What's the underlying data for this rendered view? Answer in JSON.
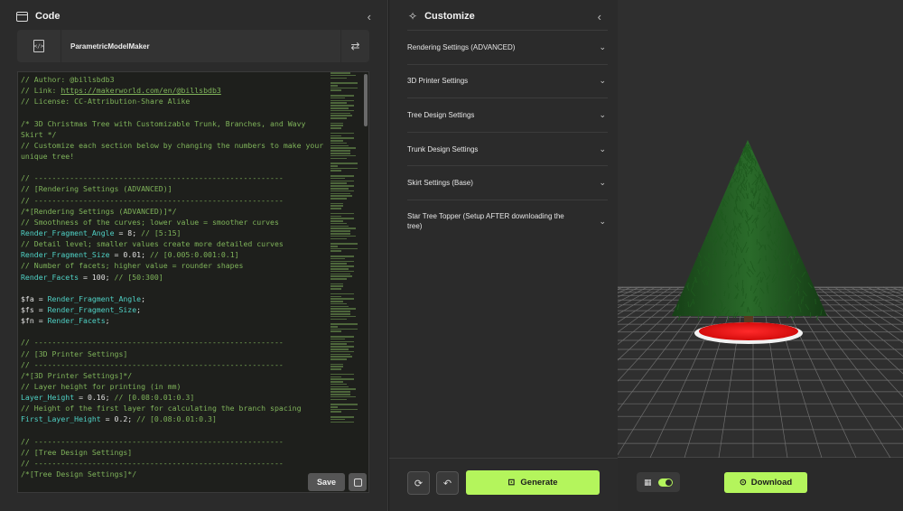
{
  "code_panel": {
    "title": "Code",
    "file_name": "ParametricModelMaker",
    "save_label": "Save",
    "lines": [
      [
        [
          "c-com",
          "// Author: @billsbdb3"
        ]
      ],
      [
        [
          "c-com",
          "// Link: "
        ],
        [
          "c-link",
          "https://makerworld.com/en/@billsbdb3"
        ]
      ],
      [
        [
          "c-com",
          "// License: CC-Attribution-Share Alike"
        ]
      ],
      [],
      [
        [
          "c-com",
          "/* 3D Christmas Tree with Customizable Trunk, Branches, and Wavy"
        ]
      ],
      [
        [
          "c-com",
          "Skirt */"
        ]
      ],
      [
        [
          "c-com",
          "// Customize each section below by changing the numbers to make your"
        ]
      ],
      [
        [
          "c-com",
          "unique tree!"
        ]
      ],
      [],
      [
        [
          "c-com",
          "// --------------------------------------------------------"
        ]
      ],
      [
        [
          "c-com",
          "// [Rendering Settings (ADVANCED)]"
        ]
      ],
      [
        [
          "c-com",
          "// --------------------------------------------------------"
        ]
      ],
      [
        [
          "c-com",
          "/*[Rendering Settings (ADVANCED)]*/"
        ]
      ],
      [
        [
          "c-com",
          "// Smoothness of the curves; lower value = smoother curves"
        ]
      ],
      [
        [
          "c-var",
          "Render_Fragment_Angle"
        ],
        [
          "c-txt",
          " = 8; "
        ],
        [
          "c-com",
          "// [5:15]"
        ]
      ],
      [
        [
          "c-com",
          "// Detail level; smaller values create more detailed curves"
        ]
      ],
      [
        [
          "c-var",
          "Render_Fragment_Size"
        ],
        [
          "c-txt",
          " = 0.01; "
        ],
        [
          "c-com",
          "// [0.005:0.001:0.1]"
        ]
      ],
      [
        [
          "c-com",
          "// Number of facets; higher value = rounder shapes"
        ]
      ],
      [
        [
          "c-var",
          "Render_Facets"
        ],
        [
          "c-txt",
          " = 100; "
        ],
        [
          "c-com",
          "// [50:300]"
        ]
      ],
      [],
      [
        [
          "c-txt",
          "$fa = "
        ],
        [
          "c-var",
          "Render_Fragment_Angle"
        ],
        [
          "c-txt",
          ";"
        ]
      ],
      [
        [
          "c-txt",
          "$fs = "
        ],
        [
          "c-var",
          "Render_Fragment_Size"
        ],
        [
          "c-txt",
          ";"
        ]
      ],
      [
        [
          "c-txt",
          "$fn = "
        ],
        [
          "c-var",
          "Render_Facets"
        ],
        [
          "c-txt",
          ";"
        ]
      ],
      [],
      [
        [
          "c-com",
          "// --------------------------------------------------------"
        ]
      ],
      [
        [
          "c-com",
          "// [3D Printer Settings]"
        ]
      ],
      [
        [
          "c-com",
          "// --------------------------------------------------------"
        ]
      ],
      [
        [
          "c-com",
          "/*[3D Printer Settings]*/"
        ]
      ],
      [
        [
          "c-com",
          "// Layer height for printing (in mm)"
        ]
      ],
      [
        [
          "c-var",
          "Layer_Height"
        ],
        [
          "c-txt",
          " = 0.16; "
        ],
        [
          "c-com",
          "// [0.08:0.01:0.3]"
        ]
      ],
      [
        [
          "c-com",
          "// Height of the first layer for calculating the branch spacing"
        ]
      ],
      [
        [
          "c-var",
          "First_Layer_Height"
        ],
        [
          "c-txt",
          " = 0.2; "
        ],
        [
          "c-com",
          "// [0.08:0.01:0.3]"
        ]
      ],
      [],
      [
        [
          "c-com",
          "// --------------------------------------------------------"
        ]
      ],
      [
        [
          "c-com",
          "// [Tree Design Settings]"
        ]
      ],
      [
        [
          "c-com",
          "// --------------------------------------------------------"
        ]
      ],
      [
        [
          "c-com",
          "/*[Tree Design Settings]*/"
        ]
      ]
    ]
  },
  "customize_panel": {
    "title": "Customize",
    "sections": [
      "Rendering Settings (ADVANCED)",
      "3D Printer Settings",
      "Tree Design Settings",
      "Trunk Design Settings",
      "Skirt Settings (Base)",
      "Star Tree Topper (Setup AFTER downloading the tree)"
    ],
    "generate_label": "Generate"
  },
  "viewport": {
    "download_label": "Download",
    "grid_toggle_on": true,
    "colors": {
      "tree": "#1f5a1f",
      "skirt": "#e01010",
      "accent": "#b4f55c"
    }
  }
}
